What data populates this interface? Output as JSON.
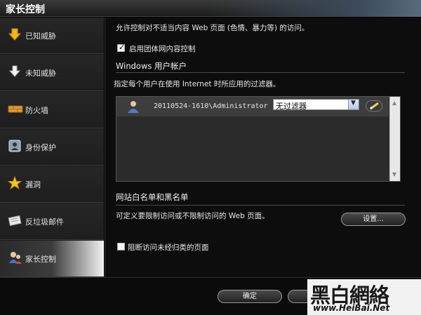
{
  "window": {
    "title": "家长控制"
  },
  "sidebar": {
    "items": [
      {
        "label": "已知威胁",
        "icon": "arrow-down-yellow-icon"
      },
      {
        "label": "未知威胁",
        "icon": "arrow-down-white-icon"
      },
      {
        "label": "防火墙",
        "icon": "firewall-icon"
      },
      {
        "label": "身份保护",
        "icon": "identity-protection-icon"
      },
      {
        "label": "漏洞",
        "icon": "star-icon"
      },
      {
        "label": "反垃圾邮件",
        "icon": "mail-icon"
      },
      {
        "label": "家长控制",
        "icon": "parental-control-icon",
        "active": true
      }
    ]
  },
  "main": {
    "intro": "允许控制对不适当内容 Web 页面 (色情、暴力等) 的访问。",
    "enable_checkbox": {
      "label": "启用团体网内容控制",
      "checked": true
    },
    "accounts": {
      "heading": "Windows 用户帐户",
      "description": "指定每个用户在使用 Internet 时所应用的过滤器。",
      "rows": [
        {
          "user": "20110524-1610\\Administrator",
          "filter": "无过滤器"
        }
      ]
    },
    "lists": {
      "heading": "网站白名单和黑名单",
      "description": "可定义要限制访问或不限制访问的 Web 页面。",
      "settings_button": "设置..."
    },
    "block_checkbox": {
      "label": "阻断访问未经归类的页面",
      "checked": false
    }
  },
  "footer": {
    "ok_button": "确定"
  },
  "watermark": {
    "text": "黑白網絡",
    "url": "www.HeiBai.Net"
  },
  "colors": {
    "background": "#0d0d0d",
    "accent_yellow": "#f0c020",
    "panel": "#2b2b2b"
  }
}
